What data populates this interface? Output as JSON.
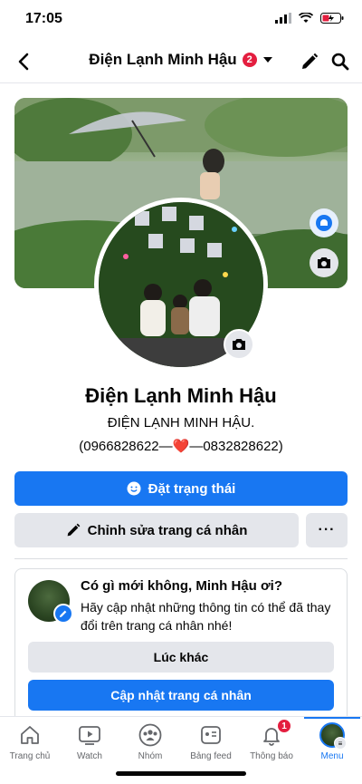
{
  "status_bar": {
    "time": "17:05"
  },
  "header": {
    "title": "Điện Lạnh Minh Hậu",
    "badge": "2"
  },
  "profile": {
    "name": "Điện Lạnh Minh Hậu",
    "bio_line1": "ĐIỆN LẠNH MINH HẬU.",
    "bio_line2": "(0966828622—❤️—0832828622)"
  },
  "actions": {
    "status_label": "Đặt trạng thái",
    "edit_label": "Chỉnh sửa trang cá nhân",
    "more_label": "···"
  },
  "update_card": {
    "title": "Có gì mới không, Minh Hậu ơi?",
    "description": "Hãy cập nhật những thông tin có thể đã thay đổi trên trang cá nhân nhé!",
    "later_label": "Lúc khác",
    "update_label": "Cập nhật trang cá nhân"
  },
  "bottom_nav": {
    "items": [
      {
        "label": "Trang chủ",
        "icon": "home-icon"
      },
      {
        "label": "Watch",
        "icon": "watch-icon"
      },
      {
        "label": "Nhóm",
        "icon": "groups-icon"
      },
      {
        "label": "Bảng feed",
        "icon": "feed-icon"
      },
      {
        "label": "Thông báo",
        "icon": "bell-icon",
        "badge": "1"
      },
      {
        "label": "Menu",
        "icon": "menu-avatar",
        "active": true
      }
    ]
  },
  "colors": {
    "accent": "#1877f2",
    "badge": "#e41e3f",
    "button_gray": "#e4e6eb"
  }
}
